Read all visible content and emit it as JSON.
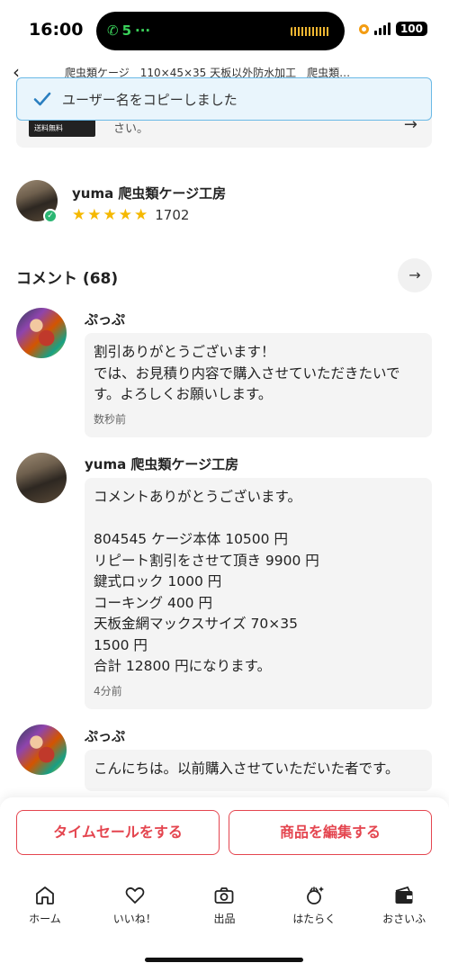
{
  "status_bar": {
    "time": "16:00",
    "call_label": "5",
    "battery": "100"
  },
  "header": {
    "item_title": "爬虫類ケージ　110×45×35 天板以外防水加工　爬虫類…"
  },
  "toast": {
    "message": "ユーザー名をコピーしました"
  },
  "shipping": {
    "thumb_label": "送料無料",
    "text": "さい。"
  },
  "seller": {
    "name": "yuma 爬虫類ケージ工房",
    "rating_count": "1702",
    "stars": 5
  },
  "comments_section": {
    "heading": "コメント (68)"
  },
  "comments": [
    {
      "name": "ぷっぷ",
      "text": "割引ありがとうございます！\nでは、お見積り内容で購入させていただきたいです。よろしくお願いします。",
      "time": "数秒前"
    },
    {
      "name": "yuma 爬虫類ケージ工房",
      "text": "コメントありがとうございます。\n\n804545 ケージ本体 10500 円\nリピート割引をさせて頂き 9900 円\n鍵式ロック 1000 円\nコーキング 400 円\n天板金網マックスサイズ 70×35\n1500 円\n合計 12800 円になります。",
      "time": "4分前"
    },
    {
      "name": "ぷっぷ",
      "text": "こんにちは。以前購入させていただいた者です。",
      "time": ""
    }
  ],
  "actions": {
    "timesale_label": "タイムセールをする",
    "edit_label": "商品を編集する"
  },
  "tabbar": {
    "home": "ホーム",
    "likes": "いいね！",
    "sell": "出品",
    "work": "はたらく",
    "wallet": "おさいふ"
  },
  "colors": {
    "accent_red": "#e4454f",
    "star": "#f5b800",
    "toast_border": "#6ab9e6"
  }
}
